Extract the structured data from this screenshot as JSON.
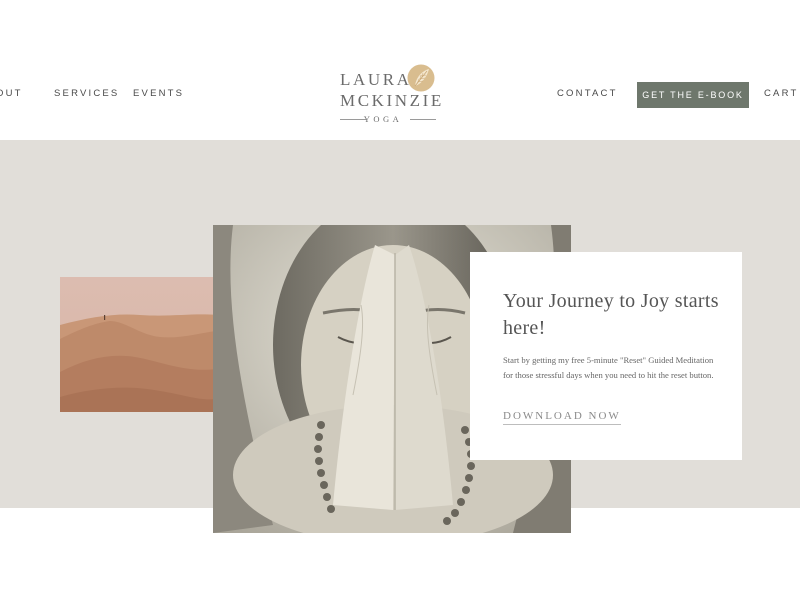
{
  "nav": {
    "left": [
      {
        "label": "OUT"
      },
      {
        "label": "SERVICES"
      },
      {
        "label": "EVENTS"
      }
    ],
    "contact": "CONTACT",
    "cta": "GET THE E-BOOK",
    "cart": "CART ("
  },
  "logo": {
    "line1": "LAURA",
    "line2": "MCKINZIE",
    "line3": "YOGA"
  },
  "hero": {
    "title": "Your Journey to Joy starts here!",
    "body": "Start by getting my free 5-minute \"Reset\" Guided Meditation for those stressful days when you need to hit the reset button.",
    "link": "DOWNLOAD NOW"
  },
  "colors": {
    "accent_button": "#6e776c",
    "hero_background": "#e1ded9",
    "leaf_gold": "#c9a775"
  }
}
